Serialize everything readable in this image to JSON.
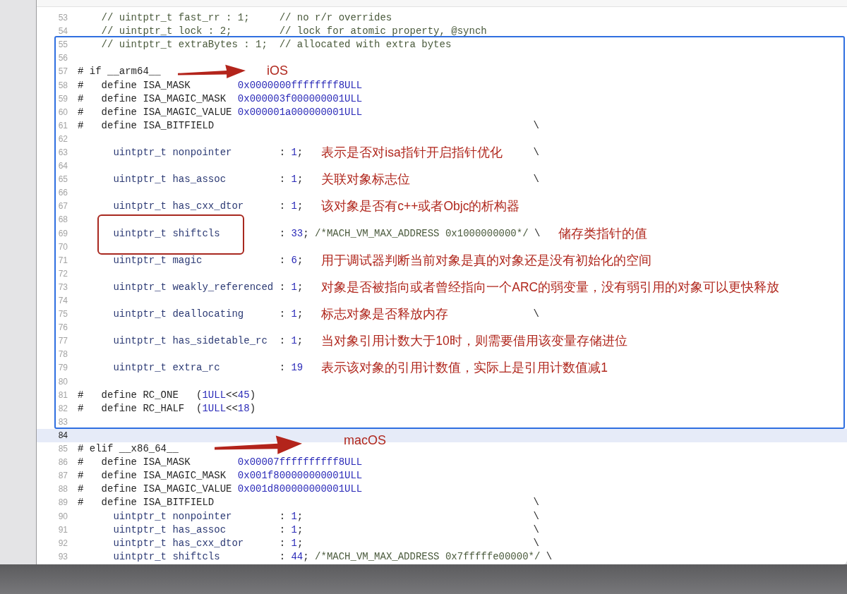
{
  "editor": {
    "lines": [
      {
        "n": "53",
        "current": false,
        "code": [
          {
            "t": "    // uintptr_t fast_rr : 1;     // no r/r overrides",
            "kind": "comment"
          }
        ]
      },
      {
        "n": "54",
        "current": false,
        "code": [
          {
            "t": "    // uintptr_t lock : 2;        // lock for atomic property, @synch",
            "kind": "comment"
          }
        ]
      },
      {
        "n": "55",
        "current": false,
        "code": [
          {
            "t": "    // uintptr_t extraBytes : 1;  // allocated with extra bytes",
            "kind": "comment"
          }
        ]
      },
      {
        "n": "56",
        "current": false
      },
      {
        "n": "57",
        "current": false,
        "code": [
          {
            "t": "# if __arm64__",
            "kind": "plain"
          }
        ]
      },
      {
        "n": "58",
        "current": false,
        "code": [
          {
            "t": "#   define ISA_MASK        ",
            "kind": "plain"
          },
          {
            "t": "0x0000000ffffffff8ULL",
            "kind": "number"
          }
        ]
      },
      {
        "n": "59",
        "current": false,
        "code": [
          {
            "t": "#   define ISA_MAGIC_MASK  ",
            "kind": "plain"
          },
          {
            "t": "0x000003f000000001ULL",
            "kind": "number"
          }
        ]
      },
      {
        "n": "60",
        "current": false,
        "code": [
          {
            "t": "#   define ISA_MAGIC_VALUE ",
            "kind": "plain"
          },
          {
            "t": "0x000001a000000001ULL",
            "kind": "number"
          }
        ]
      },
      {
        "n": "61",
        "current": false,
        "code": [
          {
            "t": "#   define ISA_BITFIELD",
            "kind": "plain"
          }
        ],
        "tail": "\\"
      },
      {
        "n": "62",
        "current": false
      },
      {
        "n": "63",
        "current": false,
        "code": [
          {
            "t": "      uintptr_t nonpointer",
            "kind": "type"
          },
          {
            "t": "        : ",
            "kind": "plain"
          },
          {
            "t": "1",
            "kind": "number"
          },
          {
            "t": ";",
            "kind": "plain"
          }
        ],
        "note": "表示是否对isa指针开启指针优化",
        "tail": "\\"
      },
      {
        "n": "64",
        "current": false
      },
      {
        "n": "65",
        "current": false,
        "code": [
          {
            "t": "      uintptr_t has_assoc",
            "kind": "type"
          },
          {
            "t": "         : ",
            "kind": "plain"
          },
          {
            "t": "1",
            "kind": "number"
          },
          {
            "t": ";",
            "kind": "plain"
          }
        ],
        "note": "关联对象标志位",
        "tail": "\\"
      },
      {
        "n": "66",
        "current": false
      },
      {
        "n": "67",
        "current": false,
        "code": [
          {
            "t": "      uintptr_t has_cxx_dtor",
            "kind": "type"
          },
          {
            "t": "      : ",
            "kind": "plain"
          },
          {
            "t": "1",
            "kind": "number"
          },
          {
            "t": ";",
            "kind": "plain"
          }
        ],
        "note": "该对象是否有c++或者Objc的析构器"
      },
      {
        "n": "68",
        "current": false
      },
      {
        "n": "69",
        "current": false,
        "code": [
          {
            "t": "      uintptr_t shiftcls",
            "kind": "type"
          },
          {
            "t": "          : ",
            "kind": "plain"
          },
          {
            "t": "33",
            "kind": "number"
          },
          {
            "t": "; ",
            "kind": "plain"
          },
          {
            "t": "/*MACH_VM_MAX_ADDRESS 0x1000000000*/",
            "kind": "comment"
          },
          {
            "t": " \\",
            "kind": "plain"
          }
        ],
        "note": "储存类指针的值"
      },
      {
        "n": "70",
        "current": false
      },
      {
        "n": "71",
        "current": false,
        "code": [
          {
            "t": "      uintptr_t magic",
            "kind": "type"
          },
          {
            "t": "             : ",
            "kind": "plain"
          },
          {
            "t": "6",
            "kind": "number"
          },
          {
            "t": ";",
            "kind": "plain"
          }
        ],
        "note": "用于调试器判断当前对象是真的对象还是没有初始化的空间"
      },
      {
        "n": "72",
        "current": false
      },
      {
        "n": "73",
        "current": false,
        "code": [
          {
            "t": "      uintptr_t weakly_referenced",
            "kind": "type"
          },
          {
            "t": " : ",
            "kind": "plain"
          },
          {
            "t": "1",
            "kind": "number"
          },
          {
            "t": ";",
            "kind": "plain"
          }
        ],
        "note": "对象是否被指向或者曾经指向一个ARC的弱变量，没有弱引用的对象可以更快释放"
      },
      {
        "n": "74",
        "current": false
      },
      {
        "n": "75",
        "current": false,
        "code": [
          {
            "t": "      uintptr_t deallocating",
            "kind": "type"
          },
          {
            "t": "      : ",
            "kind": "plain"
          },
          {
            "t": "1",
            "kind": "number"
          },
          {
            "t": ";",
            "kind": "plain"
          }
        ],
        "note": "标志对象是否释放内存",
        "tail": "\\"
      },
      {
        "n": "76",
        "current": false
      },
      {
        "n": "77",
        "current": false,
        "code": [
          {
            "t": "      uintptr_t has_sidetable_rc",
            "kind": "type"
          },
          {
            "t": "  : ",
            "kind": "plain"
          },
          {
            "t": "1",
            "kind": "number"
          },
          {
            "t": ";",
            "kind": "plain"
          }
        ],
        "note": "当对象引用计数大于10时，则需要借用该变量存储进位"
      },
      {
        "n": "78",
        "current": false
      },
      {
        "n": "79",
        "current": false,
        "code": [
          {
            "t": "      uintptr_t extra_rc",
            "kind": "type"
          },
          {
            "t": "          : ",
            "kind": "plain"
          },
          {
            "t": "19",
            "kind": "number"
          }
        ],
        "note": "表示该对象的引用计数值，实际上是引用计数值减1"
      },
      {
        "n": "80",
        "current": false
      },
      {
        "n": "81",
        "current": false,
        "code": [
          {
            "t": "#   define RC_ONE   (",
            "kind": "plain"
          },
          {
            "t": "1ULL",
            "kind": "number"
          },
          {
            "t": "<<",
            "kind": "plain"
          },
          {
            "t": "45",
            "kind": "number"
          },
          {
            "t": ")",
            "kind": "plain"
          }
        ]
      },
      {
        "n": "82",
        "current": false,
        "code": [
          {
            "t": "#   define RC_HALF  (",
            "kind": "plain"
          },
          {
            "t": "1ULL",
            "kind": "number"
          },
          {
            "t": "<<",
            "kind": "plain"
          },
          {
            "t": "18",
            "kind": "number"
          },
          {
            "t": ")",
            "kind": "plain"
          }
        ]
      },
      {
        "n": "83",
        "current": false
      },
      {
        "n": "84",
        "current": true
      },
      {
        "n": "85",
        "current": false,
        "code": [
          {
            "t": "# elif __x86_64__",
            "kind": "plain"
          }
        ]
      },
      {
        "n": "86",
        "current": false,
        "code": [
          {
            "t": "#   define ISA_MASK        ",
            "kind": "plain"
          },
          {
            "t": "0x00007ffffffffff8ULL",
            "kind": "number"
          }
        ]
      },
      {
        "n": "87",
        "current": false,
        "code": [
          {
            "t": "#   define ISA_MAGIC_MASK  ",
            "kind": "plain"
          },
          {
            "t": "0x001f800000000001ULL",
            "kind": "number"
          }
        ]
      },
      {
        "n": "88",
        "current": false,
        "code": [
          {
            "t": "#   define ISA_MAGIC_VALUE ",
            "kind": "plain"
          },
          {
            "t": "0x001d800000000001ULL",
            "kind": "number"
          }
        ]
      },
      {
        "n": "89",
        "current": false,
        "code": [
          {
            "t": "#   define ISA_BITFIELD",
            "kind": "plain"
          }
        ],
        "tail": "\\"
      },
      {
        "n": "90",
        "current": false,
        "code": [
          {
            "t": "      uintptr_t nonpointer",
            "kind": "type"
          },
          {
            "t": "        : ",
            "kind": "plain"
          },
          {
            "t": "1",
            "kind": "number"
          },
          {
            "t": ";",
            "kind": "plain"
          }
        ],
        "tail": "\\"
      },
      {
        "n": "91",
        "current": false,
        "code": [
          {
            "t": "      uintptr_t has_assoc",
            "kind": "type"
          },
          {
            "t": "         : ",
            "kind": "plain"
          },
          {
            "t": "1",
            "kind": "number"
          },
          {
            "t": ";",
            "kind": "plain"
          }
        ],
        "tail": "\\"
      },
      {
        "n": "92",
        "current": false,
        "code": [
          {
            "t": "      uintptr_t has_cxx_dtor",
            "kind": "type"
          },
          {
            "t": "      : ",
            "kind": "plain"
          },
          {
            "t": "1",
            "kind": "number"
          },
          {
            "t": ";",
            "kind": "plain"
          }
        ],
        "tail": "\\"
      },
      {
        "n": "93",
        "current": false,
        "code": [
          {
            "t": "      uintptr_t shiftcls",
            "kind": "type"
          },
          {
            "t": "          : ",
            "kind": "plain"
          },
          {
            "t": "44",
            "kind": "number"
          },
          {
            "t": "; ",
            "kind": "plain"
          },
          {
            "t": "/*MACH_VM_MAX_ADDRESS 0x7fffffe00000*/",
            "kind": "comment"
          },
          {
            "t": " \\",
            "kind": "plain"
          }
        ]
      }
    ]
  },
  "annotations": [
    {
      "kind": "arrow",
      "label": "iOS"
    },
    {
      "kind": "arrow",
      "label": "macOS"
    },
    {
      "kind": "box"
    },
    {
      "kind": "frame"
    }
  ]
}
